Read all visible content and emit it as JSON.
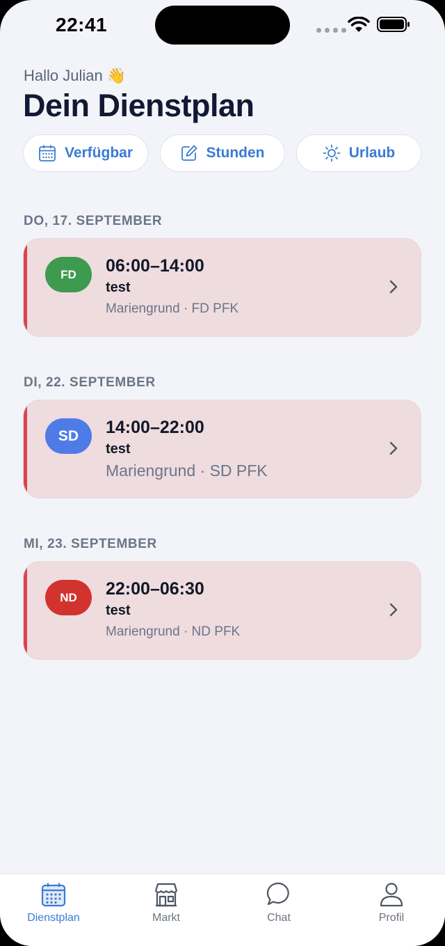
{
  "status_bar": {
    "time": "22:41"
  },
  "header": {
    "greeting": "Hallo Julian 👋",
    "title": "Dein Dienstplan"
  },
  "actions": [
    {
      "label": "Verfügbar",
      "icon": "calendar-icon"
    },
    {
      "label": "Stunden",
      "icon": "edit-icon"
    },
    {
      "label": "Urlaub",
      "icon": "sun-icon"
    }
  ],
  "days": [
    {
      "label": "DO, 17. SEPTEMBER",
      "shift": {
        "badge": "FD",
        "badge_color": "#3e9a4f",
        "time": "06:00–14:00",
        "name": "test",
        "location": "Mariengrund · FD PFK"
      }
    },
    {
      "label": "DI, 22. SEPTEMBER",
      "shift": {
        "badge": "SD",
        "badge_color": "#4f7be6",
        "time": "14:00–22:00",
        "name": "test",
        "location": "Mariengrund · SD PFK"
      }
    },
    {
      "label": "MI, 23. SEPTEMBER",
      "shift": {
        "badge": "ND",
        "badge_color": "#d2332e",
        "time": "22:00–06:30",
        "name": "test",
        "location": "Mariengrund · ND PFK"
      }
    }
  ],
  "tabs": [
    {
      "label": "Dienstplan",
      "icon": "calendar-icon",
      "active": true
    },
    {
      "label": "Markt",
      "icon": "store-icon",
      "active": false
    },
    {
      "label": "Chat",
      "icon": "chat-bubble-icon",
      "active": false
    },
    {
      "label": "Profil",
      "icon": "person-icon",
      "active": false
    }
  ],
  "colors": {
    "accent": "#3a7bd5",
    "card_bg": "#efdcdf",
    "card_stripe": "#d8454a",
    "background": "#f3f4f9"
  }
}
